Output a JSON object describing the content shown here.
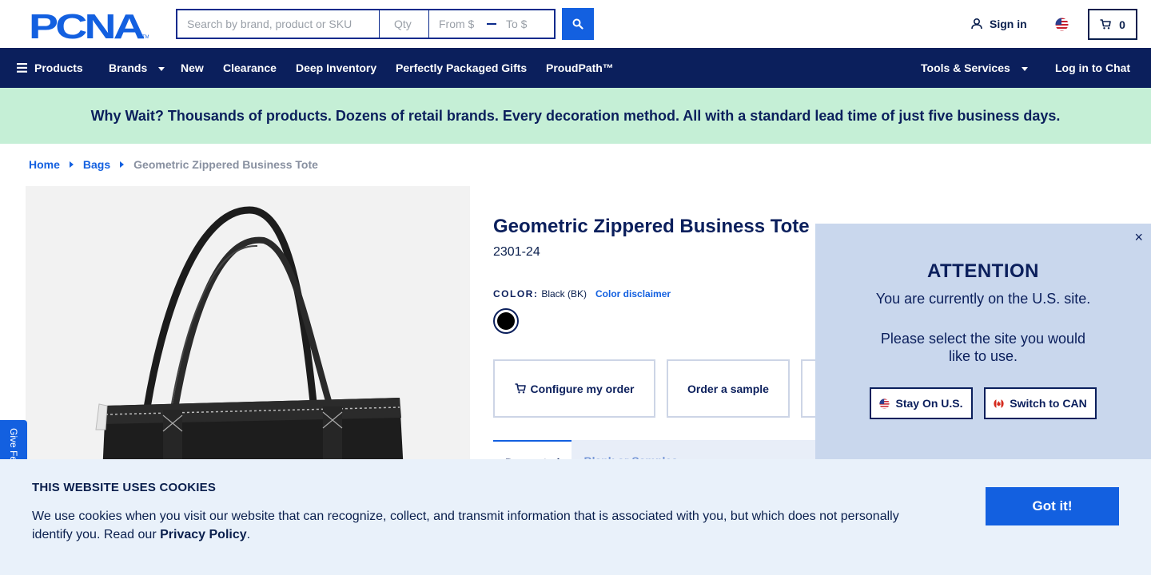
{
  "header": {
    "logo_text": "PCNA",
    "search": {
      "placeholder": "Search by brand, product or SKU",
      "value": ""
    },
    "qty": {
      "placeholder": "Qty",
      "value": ""
    },
    "price_from": {
      "placeholder": "From $",
      "value": ""
    },
    "price_to": {
      "placeholder": "To $",
      "value": ""
    },
    "signin_label": "Sign in",
    "cart_count": "0"
  },
  "nav": {
    "products": "Products",
    "brands": "Brands",
    "new": "New",
    "clearance": "Clearance",
    "deep_inventory": "Deep Inventory",
    "packaged_gifts": "Perfectly Packaged Gifts",
    "proudpath": "ProudPath™",
    "tools": "Tools & Services",
    "chat": "Log in to Chat"
  },
  "promo": {
    "text": "Why Wait? Thousands of products. Dozens of retail brands. Every decoration method. All with a standard lead time of just five business days."
  },
  "breadcrumb": {
    "home": "Home",
    "bags": "Bags",
    "current": "Geometric Zippered Business Tote"
  },
  "product": {
    "title": "Geometric Zippered Business Tote",
    "sku": "2301-24",
    "color_label": "COLOR:",
    "color_value": "Black (BK)",
    "color_disclaimer": "Color disclaimer",
    "swatch_color": "#000000",
    "actions": {
      "configure": "Configure my order",
      "sample": "Order a sample"
    },
    "tabs": {
      "active_label": "Decorated",
      "inactive_label": "Blank or Samples"
    }
  },
  "feedback": {
    "label": "Give Feedback"
  },
  "site_modal": {
    "title": "ATTENTION",
    "line1": "You are currently on the U.S. site.",
    "line2": "Please select the site you would like to use.",
    "stay": "Stay On U.S.",
    "switch": "Switch to CAN",
    "close": "×"
  },
  "cookie": {
    "title": "THIS WEBSITE USES COOKIES",
    "text": "We use cookies when you visit our website that can recognize, collect, and transmit information that is associated with you, but which does not personally identify you. Read our",
    "link": "Privacy Policy",
    "suffix": ".",
    "button": "Got it!"
  },
  "colors": {
    "navy": "#0b1f5c",
    "blue": "#1360e0",
    "promo_green": "#c5efd6",
    "modal_bg": "#c9d7ed",
    "cookie_bg": "#e9f1fa"
  }
}
